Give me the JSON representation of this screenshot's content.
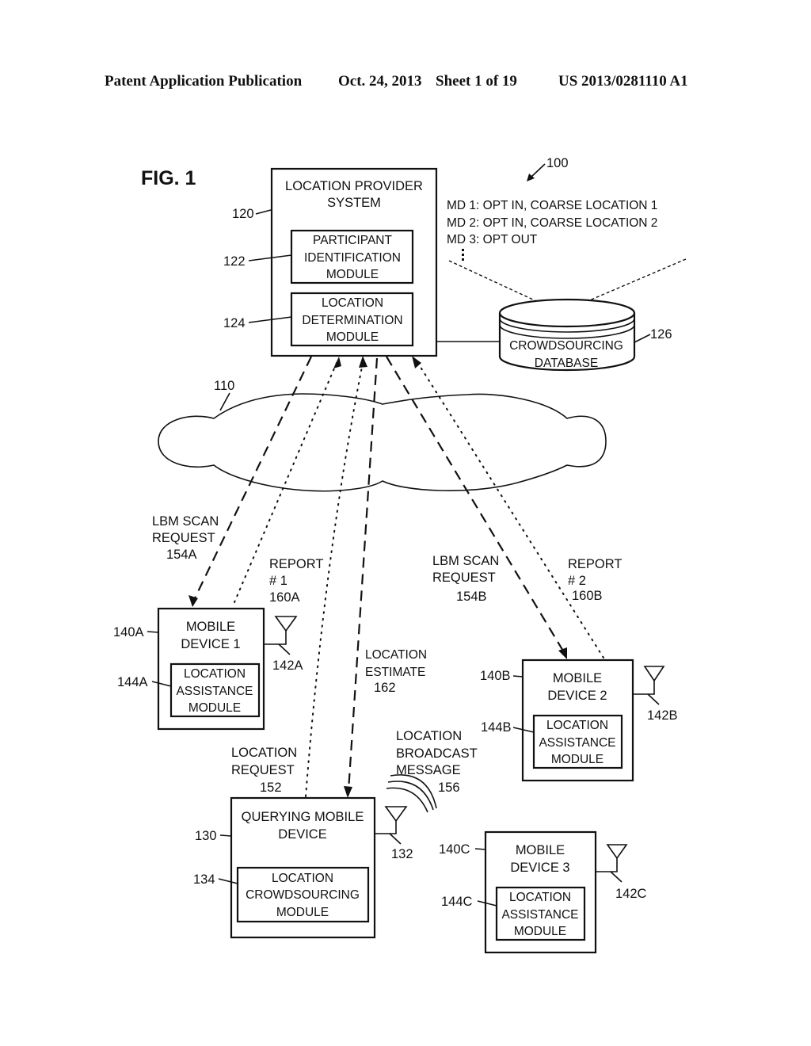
{
  "header": {
    "publication": "Patent Application Publication",
    "date": "Oct. 24, 2013",
    "sheet": "Sheet 1 of 19",
    "number": "US 2013/0281110 A1"
  },
  "figure": {
    "title": "FIG. 1",
    "ref": "100"
  },
  "provider": {
    "ref": "120",
    "title_lines": [
      "LOCATION PROVIDER",
      "SYSTEM"
    ],
    "modules": [
      {
        "ref": "122",
        "lines": [
          "PARTICIPANT",
          "IDENTIFICATION",
          "MODULE"
        ]
      },
      {
        "ref": "124",
        "lines": [
          "LOCATION",
          "DETERMINATION",
          "MODULE"
        ]
      }
    ]
  },
  "database": {
    "ref": "126",
    "lines": [
      "CROWDSOURCING",
      "DATABASE"
    ],
    "records": [
      "MD 1:  OPT IN, COARSE LOCATION 1",
      "MD 2:  OPT IN, COARSE LOCATION 2",
      "MD 3:  OPT OUT"
    ],
    "ellipsis": "⋮"
  },
  "network": {
    "ref": "110"
  },
  "devices": [
    {
      "ref": "140A",
      "title_lines": [
        "MOBILE",
        "DEVICE 1"
      ],
      "module_ref": "144A",
      "module_lines": [
        "LOCATION",
        "ASSISTANCE",
        "MODULE"
      ],
      "antenna_ref": "142A"
    },
    {
      "ref": "140B",
      "title_lines": [
        "MOBILE",
        "DEVICE 2"
      ],
      "module_ref": "144B",
      "module_lines": [
        "LOCATION",
        "ASSISTANCE",
        "MODULE"
      ],
      "antenna_ref": "142B"
    },
    {
      "ref": "140C",
      "title_lines": [
        "MOBILE",
        "DEVICE 3"
      ],
      "module_ref": "144C",
      "module_lines": [
        "LOCATION",
        "ASSISTANCE",
        "MODULE"
      ],
      "antenna_ref": "142C"
    }
  ],
  "querying_device": {
    "ref": "130",
    "title_lines": [
      "QUERYING MOBILE",
      "DEVICE"
    ],
    "module_ref": "134",
    "module_lines": [
      "LOCATION",
      "CROWDSOURCING",
      "MODULE"
    ],
    "antenna_ref": "132"
  },
  "messages": {
    "lbm_scan_a": [
      "LBM SCAN",
      "REQUEST",
      "154A"
    ],
    "report_1": [
      "REPORT",
      "# 1",
      "160A"
    ],
    "lbm_scan_b": [
      "LBM SCAN",
      "REQUEST",
      "154B"
    ],
    "report_2": [
      "REPORT",
      "# 2",
      "160B"
    ],
    "location_estimate": [
      "LOCATION",
      "ESTIMATE",
      "162"
    ],
    "location_request": [
      "LOCATION",
      "REQUEST",
      "152"
    ],
    "location_broadcast": [
      "LOCATION",
      "BROADCAST",
      "MESSAGE",
      "156"
    ]
  }
}
